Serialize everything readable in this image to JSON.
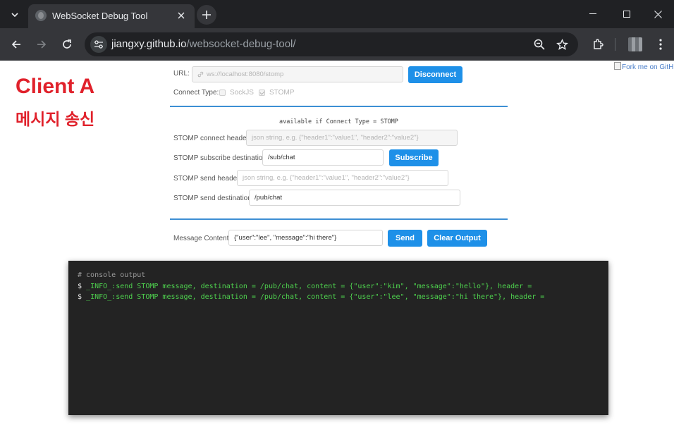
{
  "browser": {
    "tab_title": "WebSocket Debug Tool",
    "url_host": "jiangxy.github.io",
    "url_path": "/websocket-debug-tool/"
  },
  "annotation": {
    "title": "Client A",
    "subtitle": "메시지 송신"
  },
  "fork_link": "Fork me on GitHub",
  "form": {
    "url_label": "URL:",
    "url_value": "ws://localhost:8080/stomp",
    "disconnect_label": "Disconnect",
    "connect_type_label": "Connect Type:",
    "sockjs_label": "SockJS",
    "stomp_label": "STOMP",
    "sockjs_checked": false,
    "stomp_checked": true,
    "stomp_note": "available if Connect Type = STOMP",
    "connect_header_label": "STOMP connect header:",
    "connect_header_placeholder": "json string, e.g. {\"header1\":\"value1\", \"header2\":\"value2\"}",
    "subscribe_dest_label": "STOMP subscribe destination:",
    "subscribe_dest_value": "/sub/chat",
    "subscribe_label": "Subscribe",
    "send_header_label": "STOMP send header:",
    "send_header_placeholder": "json string, e.g. {\"header1\":\"value1\", \"header2\":\"value2\"}",
    "send_dest_label": "STOMP send destination:",
    "send_dest_value": "/pub/chat",
    "message_label": "Message Content:",
    "message_value": "{\"user\":\"lee\", \"message\":\"hi there\"}",
    "send_label": "Send",
    "clear_label": "Clear Output"
  },
  "console": {
    "header": "# console output",
    "prompt": "$",
    "lines": [
      "_INFO_:send STOMP message, destination = /pub/chat, content = {\"user\":\"kim\", \"message\":\"hello\"}, header =",
      "_INFO_:send STOMP message, destination = /pub/chat, content = {\"user\":\"lee\", \"message\":\"hi there\"}, header ="
    ]
  }
}
